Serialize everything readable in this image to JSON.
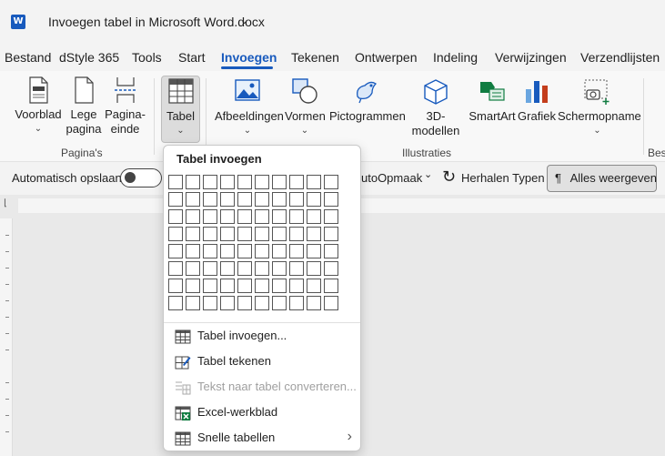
{
  "titlebar": {
    "app_logo": "W",
    "document_title": "Invoegen tabel in Microsoft Word.docx",
    "chevron": "⌄"
  },
  "menu": {
    "tabs": [
      "Bestand",
      "dStyle 365",
      "Tools",
      "Start",
      "Invoegen",
      "Tekenen",
      "Ontwerpen",
      "Indeling",
      "Verwijzingen",
      "Verzendlijsten"
    ],
    "active_tab": "Invoegen"
  },
  "ribbon": {
    "paginas": {
      "voorblad": "Voorblad",
      "lege_1": "Lege",
      "lege_2": "pagina",
      "einde_1": "Pagina-",
      "einde_2": "einde",
      "group_label": "Pagina's"
    },
    "tabel": {
      "label": "Tabel"
    },
    "illustraties": {
      "afbeeldingen": "Afbeeldingen",
      "vormen": "Vormen",
      "pictogrammen": "Pictogrammen",
      "modellen_1": "3D-",
      "modellen_2": "modellen",
      "smartart": "SmartArt",
      "grafiek": "Grafiek",
      "schermopname": "Schermopname",
      "group_label": "Illustraties"
    },
    "overflow_group_label": "Best",
    "chevron": "⌄"
  },
  "qat": {
    "autosave_label": "Automatisch opslaan",
    "autoopmaak": "utoOpmaak",
    "dropdown_chevron": "⌄",
    "redo_icon": "↻",
    "herhalen": "Herhalen Typen",
    "alles_weergeven": "Alles weergeven",
    "pilcrow": "¶"
  },
  "dropdown": {
    "title": "Tabel invoegen",
    "grid_cols": 10,
    "grid_rows": 8,
    "items": [
      {
        "label": "Tabel invoegen...",
        "icon": "table-icon",
        "enabled": true
      },
      {
        "label": "Tabel tekenen",
        "icon": "draw-table-icon",
        "enabled": true
      },
      {
        "label": "Tekst naar tabel converteren...",
        "icon": "convert-text-icon",
        "enabled": false
      },
      {
        "label": "Excel-werkblad",
        "icon": "excel-icon",
        "enabled": true
      },
      {
        "label": "Snelle tabellen",
        "icon": "quick-tables-icon",
        "enabled": true,
        "submenu": true
      }
    ],
    "submenu_arrow": "›"
  },
  "colors": {
    "accent": "#185abd",
    "excel_green": "#107c41",
    "disabled_text": "#a0a0a0"
  }
}
